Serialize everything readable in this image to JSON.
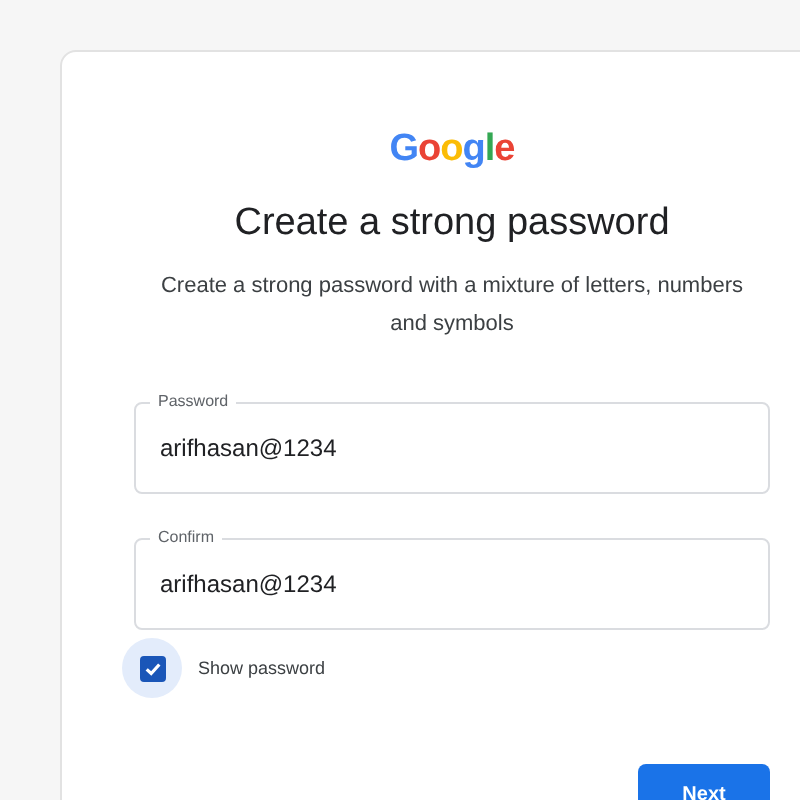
{
  "logo": "Google",
  "title": "Create a strong password",
  "subtitle": "Create a strong password with a mixture of letters, numbers and symbols",
  "fields": [
    {
      "label": "Password",
      "value": "arifhasan@1234"
    },
    {
      "label": "Confirm",
      "value": "arifhasan@1234"
    }
  ],
  "show_password": {
    "label": "Show password",
    "checked": true
  },
  "buttons": [
    {
      "label": "Next"
    }
  ]
}
